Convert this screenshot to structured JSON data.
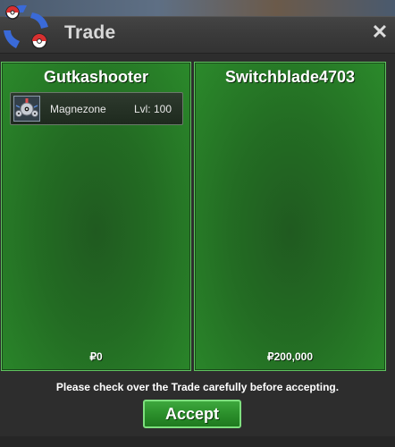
{
  "window": {
    "title": "Trade",
    "close_glyph": "✕"
  },
  "traders": [
    {
      "name": "Gutkashooter",
      "money": "₽0",
      "items": [
        {
          "icon": "magnezone-icon",
          "name": "Magnezone",
          "level": "Lvl: 100"
        }
      ]
    },
    {
      "name": "Switchblade4703",
      "money": "₽200,000",
      "items": []
    }
  ],
  "notice": "Please check over the Trade carefully before accepting.",
  "accept_label": "Accept",
  "colors": {
    "panel_green": "#236c23",
    "border_green": "#5fc35f",
    "accept_green": "#2b8f2b"
  }
}
